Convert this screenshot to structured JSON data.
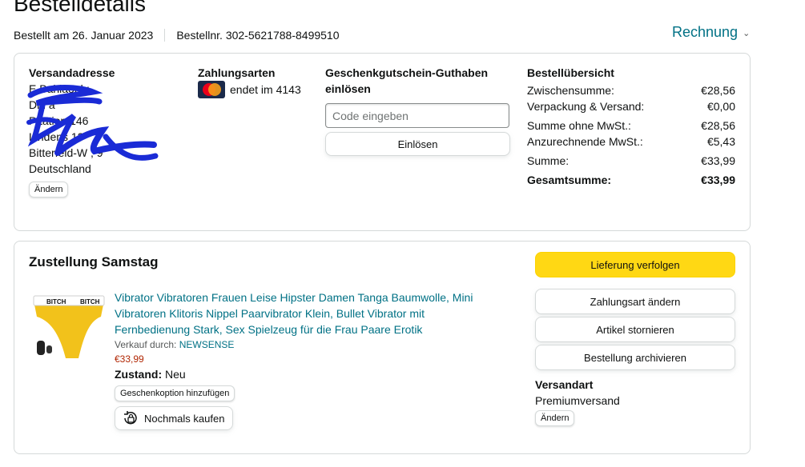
{
  "header": {
    "title": "Bestelldetails",
    "ordered_on": "Bestellt am 26. Januar 2023",
    "order_number": "Bestellnr. 302-5621788-8499510",
    "invoice_label": "Rechnung"
  },
  "address": {
    "heading": "Versandadresse",
    "lines": [
      "E        Bahlaoglu",
      "Dril   a",
      "P   tation 146",
      "Lindens   13",
      "Bitterfeld-W      ,      9",
      "Deutschland"
    ],
    "change_label": "Ändern"
  },
  "payment": {
    "heading": "Zahlungsarten",
    "card_text": "endet im 4143",
    "card_icon": "mastercard-icon"
  },
  "gift_card": {
    "heading": "Geschenkgutschein-Guthaben einlösen",
    "placeholder": "Code eingeben",
    "redeem_label": "Einlösen"
  },
  "summary": {
    "heading": "Bestellübersicht",
    "rows": [
      {
        "label": "Zwischensumme:",
        "value": "€28,56"
      },
      {
        "label": "Verpackung & Versand:",
        "value": "€0,00"
      },
      {
        "label": "Summe ohne MwSt.:",
        "value": "€28,56"
      },
      {
        "label": "Anzurechnende MwSt.:",
        "value": "€5,43"
      },
      {
        "label": "Summe:",
        "value": "€33,99"
      },
      {
        "label": "Gesamtsumme:",
        "value": "€33,99"
      }
    ]
  },
  "delivery": {
    "title": "Zustellung Samstag",
    "product_title": "Vibrator Vibratoren Frauen Leise Hipster Damen Tanga Baumwolle, Mini Vibratoren Klitoris Nippel Paarvibrator Klein, Bullet Vibrator mit Fernbedienung Stark, Sex Spielzeug für die Frau Paare Erotik",
    "seller_prefix": "Verkauf durch: ",
    "seller_name": "NEWSENSE",
    "price": "€33,99",
    "condition_label": "Zustand:",
    "condition_value": "Neu",
    "gift_option_label": "Geschenkoption hinzufügen",
    "buy_again_label": "Nochmals kaufen",
    "image_text": "BITCH"
  },
  "actions": {
    "track": "Lieferung verfolgen",
    "change_payment": "Zahlungsart ändern",
    "cancel": "Artikel stornieren",
    "archive": "Bestellung archivieren",
    "shipping_heading": "Versandart",
    "shipping_value": "Premiumversand",
    "change_label": "Ändern"
  },
  "colors": {
    "link": "#007185",
    "price": "#b12704",
    "primary_button": "#ffd814",
    "scribble": "#1a2bd6"
  }
}
